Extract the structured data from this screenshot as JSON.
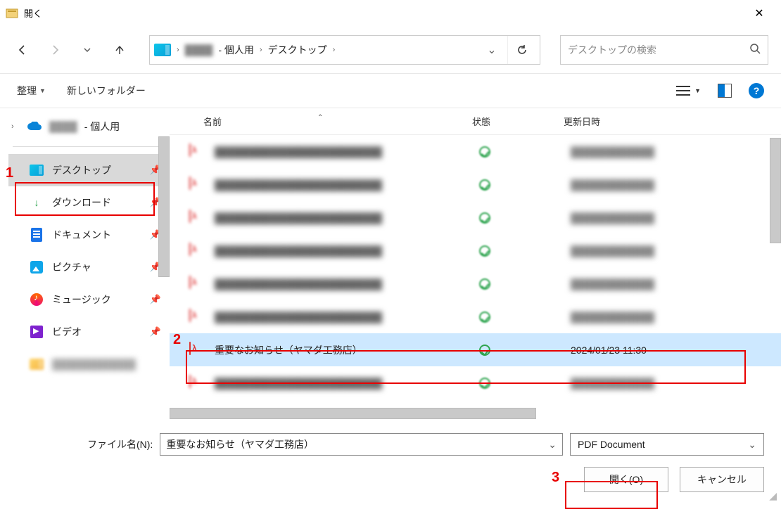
{
  "window": {
    "title": "開く"
  },
  "breadcrumb": {
    "seg_blur": "████",
    "seg2": "- 個人用",
    "seg3": "デスクトップ"
  },
  "search": {
    "placeholder": "デスクトップの検索"
  },
  "toolbar": {
    "organize": "整理",
    "new_folder": "新しいフォルダー"
  },
  "sidebar": {
    "top_blur": "████",
    "top_suffix": "- 個人用",
    "items": [
      {
        "label": "デスクトップ",
        "selected": true,
        "icon": "folder-blue"
      },
      {
        "label": "ダウンロード",
        "icon": "download"
      },
      {
        "label": "ドキュメント",
        "icon": "doc"
      },
      {
        "label": "ピクチャ",
        "icon": "picture"
      },
      {
        "label": "ミュージック",
        "icon": "music"
      },
      {
        "label": "ビデオ",
        "icon": "video"
      }
    ]
  },
  "columns": {
    "name": "名前",
    "status": "状態",
    "date": "更新日時"
  },
  "files": {
    "blur_rows": 6,
    "selected": {
      "name": "重要なお知らせ（ヤマダ工務店）",
      "date": "2024/01/23 11:30"
    },
    "blur_after": 1
  },
  "footer": {
    "filename_label": "ファイル名(N):",
    "filename_value": "重要なお知らせ（ヤマダ工務店）",
    "filetype": "PDF Document",
    "open": "開く(O)",
    "cancel": "キャンセル"
  },
  "annotations": {
    "n1": "1",
    "n2": "2",
    "n3": "3"
  }
}
